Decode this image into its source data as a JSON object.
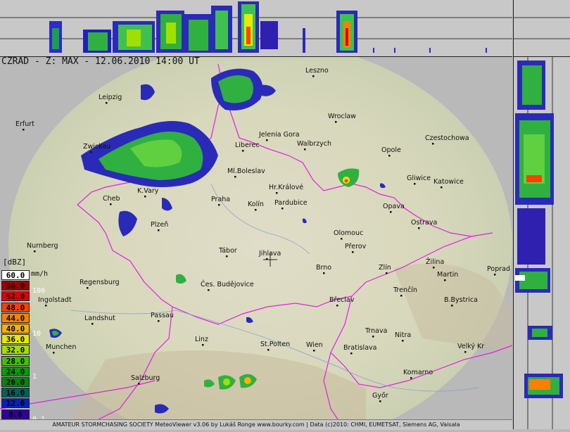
{
  "title": "CZRAD - Z: MAX - 12.06.2010 14:00 UT",
  "legend": {
    "unit": "[dBZ]",
    "rate_unit": "mm/h",
    "levels": [
      {
        "label": "60.0",
        "color": "#ffffff",
        "text": "#000000"
      },
      {
        "label": "56.0",
        "color": "#a00000",
        "text": "#000000"
      },
      {
        "label": "52.0",
        "color": "#e00000",
        "text": "#000000"
      },
      {
        "label": "48.0",
        "color": "#ff4000",
        "text": "#000000"
      },
      {
        "label": "44.0",
        "color": "#ff8000",
        "text": "#000000"
      },
      {
        "label": "40.0",
        "color": "#ffb000",
        "text": "#000000"
      },
      {
        "label": "36.0",
        "color": "#e8e800",
        "text": "#000000"
      },
      {
        "label": "32.0",
        "color": "#a0e000",
        "text": "#000000"
      },
      {
        "label": "28.0",
        "color": "#40c000",
        "text": "#000000"
      },
      {
        "label": "24.0",
        "color": "#00a000",
        "text": "#000000"
      },
      {
        "label": "20.0",
        "color": "#008800",
        "text": "#000000"
      },
      {
        "label": "16.0",
        "color": "#006060",
        "text": "#000000"
      },
      {
        "label": "12.0",
        "color": "#0020c0",
        "text": "#000000"
      },
      {
        "label": "8.0",
        "color": "#3000a0",
        "text": "#000000"
      },
      {
        "label": "4.0",
        "color": "#500080",
        "text": "#000000"
      }
    ],
    "rates": [
      "100",
      "10",
      "1",
      "0.1"
    ]
  },
  "cities": [
    {
      "name": "Leszno"
    },
    {
      "name": "Leipzig"
    },
    {
      "name": "Erfurt"
    },
    {
      "name": "Wroclaw"
    },
    {
      "name": "Jelenia Gora"
    },
    {
      "name": "Walbrzych"
    },
    {
      "name": "Czestochowa"
    },
    {
      "name": "Liberec"
    },
    {
      "name": "Zwickau"
    },
    {
      "name": "Opole"
    },
    {
      "name": "Ml.Boleslav"
    },
    {
      "name": "Gliwice"
    },
    {
      "name": "Katowice"
    },
    {
      "name": "K.Vary"
    },
    {
      "name": "Hr.Králové"
    },
    {
      "name": "Cheb"
    },
    {
      "name": "Praha"
    },
    {
      "name": "Kolín"
    },
    {
      "name": "Pardubice"
    },
    {
      "name": "Opava"
    },
    {
      "name": "Ostrava"
    },
    {
      "name": "Plzeň"
    },
    {
      "name": "Olomouc"
    },
    {
      "name": "Nurnberg"
    },
    {
      "name": "Tábor"
    },
    {
      "name": "Jihlava"
    },
    {
      "name": "Přerov"
    },
    {
      "name": "Žilina"
    },
    {
      "name": "Brno"
    },
    {
      "name": "Zlín"
    },
    {
      "name": "Martin"
    },
    {
      "name": "Poprad"
    },
    {
      "name": "Regensburg"
    },
    {
      "name": "Čes. Budějovice"
    },
    {
      "name": "Trenčín"
    },
    {
      "name": "Ingolstadt"
    },
    {
      "name": "Břeclav"
    },
    {
      "name": "B.Bystrica"
    },
    {
      "name": "Passau"
    },
    {
      "name": "Landshut"
    },
    {
      "name": "Trnava"
    },
    {
      "name": "Nitra"
    },
    {
      "name": "Linz"
    },
    {
      "name": "Munchen"
    },
    {
      "name": "St.Polten"
    },
    {
      "name": "Wien"
    },
    {
      "name": "Bratislava"
    },
    {
      "name": "Velký Kr"
    },
    {
      "name": "Salzburg"
    },
    {
      "name": "Komarno"
    },
    {
      "name": "Győr"
    }
  ],
  "footer": "AMATEUR STORMCHASING SOCIETY MeteoViewer v3.06 by Lukáš Ronge www.bourky.com | Data (c)2010: CHMI, EUMETSAT, Siemens AG, Vaisala"
}
